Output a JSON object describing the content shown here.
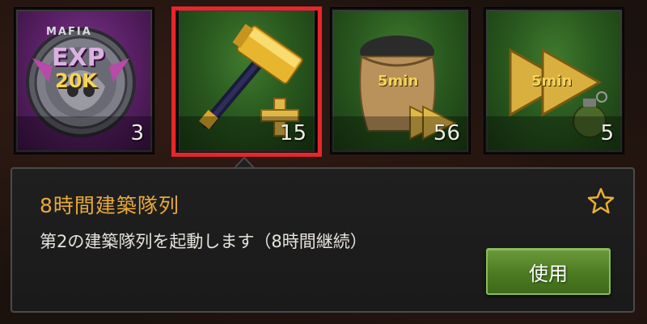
{
  "items": [
    {
      "name": "exp-medal",
      "count": "3",
      "badge_top": "EXP",
      "badge_mid": "20K",
      "ring_text": "MAFIA",
      "color": "purple"
    },
    {
      "name": "builder-hammer",
      "count": "15",
      "color": "green",
      "selected": true
    },
    {
      "name": "speedup-sack",
      "count": "56",
      "badge": "5min",
      "color": "green"
    },
    {
      "name": "speedup-grenade",
      "count": "5",
      "badge": "5min",
      "color": "green"
    }
  ],
  "detail": {
    "title": "8時間建築隊列",
    "description": "第2の建築隊列を起動します（8時間継続）",
    "use_label": "使用",
    "favorite_icon": "star-outline-icon"
  },
  "colors": {
    "selection_border": "#e8262a",
    "title_color": "#e9a93a",
    "button_green": "#4c7a22"
  }
}
